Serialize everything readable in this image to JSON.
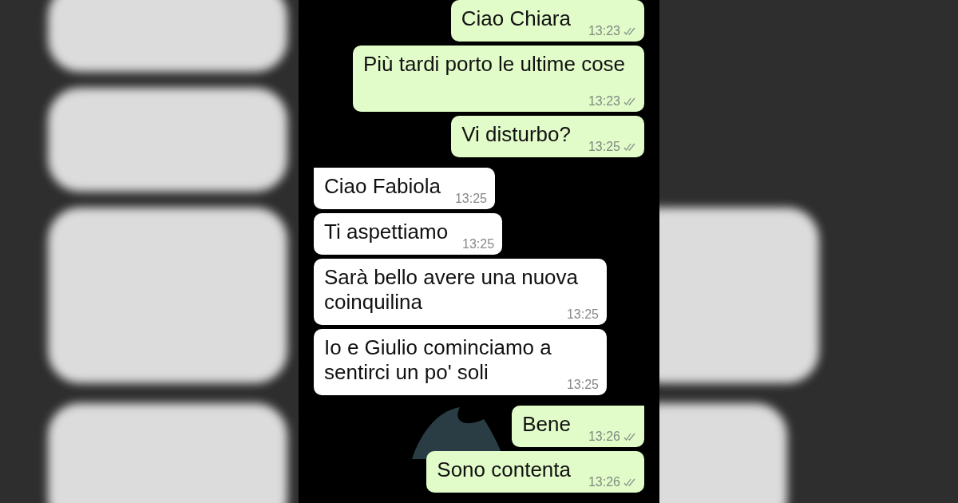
{
  "messages": [
    {
      "kind": "outgoing",
      "text": "Ciao Chiara",
      "time": "13:23",
      "tail": false
    },
    {
      "kind": "outgoing",
      "text": "Più tardi porto le ultime cose",
      "time": "13:23",
      "tail": false
    },
    {
      "kind": "outgoing",
      "text": "Vi disturbo?",
      "time": "13:25",
      "tail": false
    },
    {
      "kind": "incoming",
      "text": "Ciao Fabiola",
      "time": "13:25",
      "tail": true
    },
    {
      "kind": "incoming",
      "text": "Ti aspettiamo",
      "time": "13:25",
      "tail": false
    },
    {
      "kind": "incoming",
      "text": "Sarà bello avere una nuova coinquilina",
      "time": "13:25",
      "tail": false
    },
    {
      "kind": "incoming",
      "text": "Io e Giulio cominciamo a sentirci un po' soli",
      "time": "13:25",
      "tail": false
    },
    {
      "kind": "outgoing",
      "text": "Bene",
      "time": "13:26",
      "tail": true
    },
    {
      "kind": "outgoing",
      "text": "Sono contenta",
      "time": "13:26",
      "tail": false
    }
  ]
}
